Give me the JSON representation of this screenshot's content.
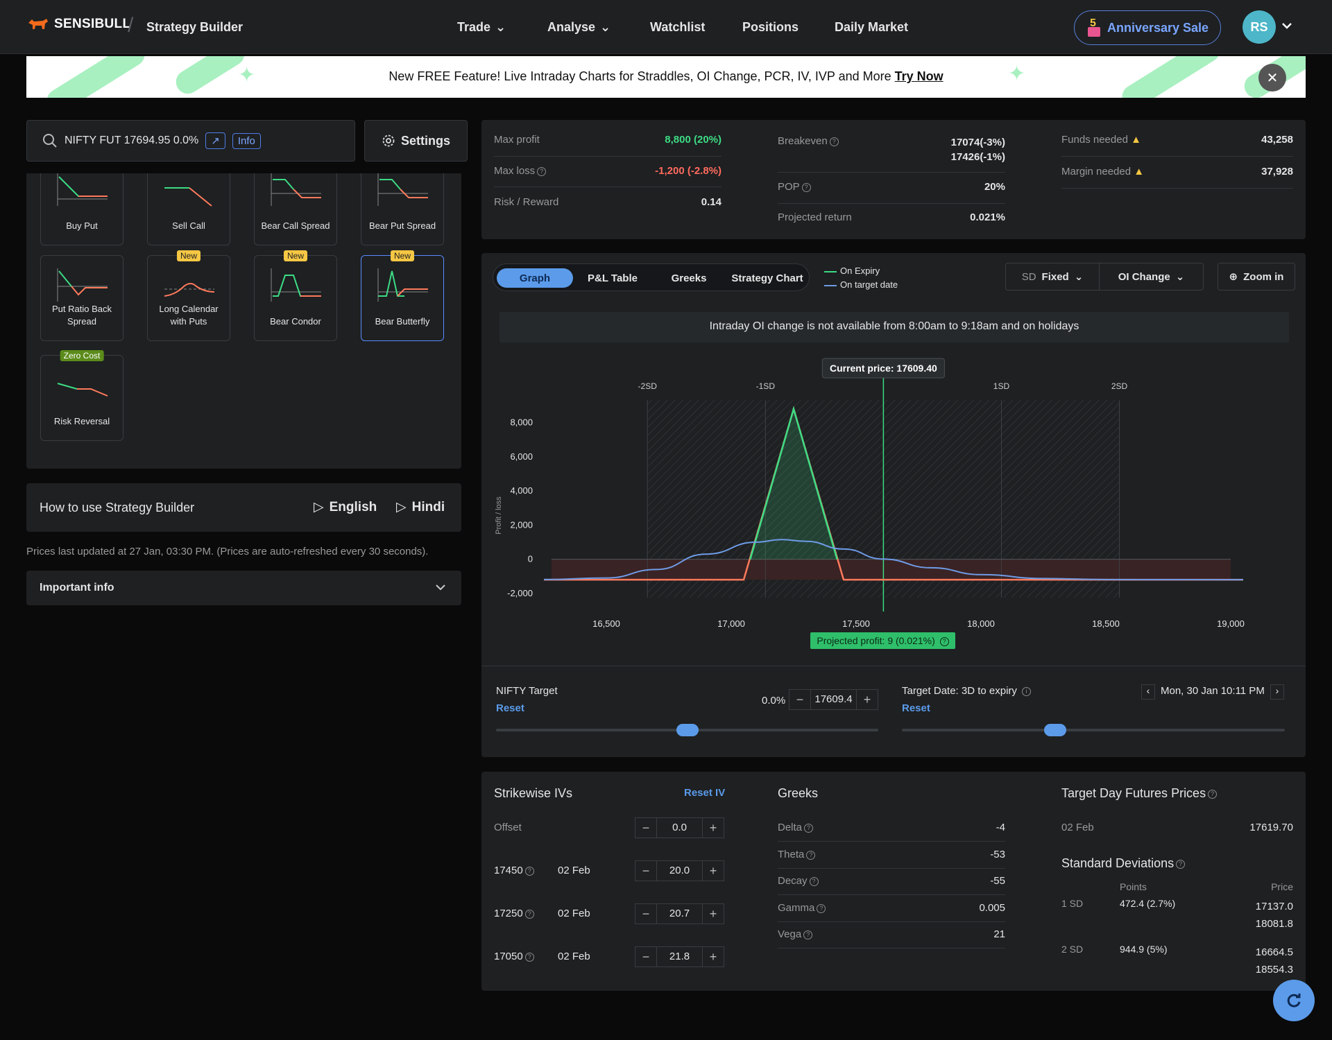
{
  "nav": {
    "brand": "SENSIBULL",
    "section": "Strategy Builder",
    "links": [
      "Trade",
      "Analyse",
      "Watchlist",
      "Positions",
      "Daily Market"
    ],
    "sale": "Anniversary Sale",
    "sale_num": "5",
    "avatar": "RS"
  },
  "banner": {
    "text": "New FREE Feature! Live Intraday Charts for Straddles, OI Change, PCR, IV, IVP and More ",
    "cta": "Try Now"
  },
  "search": {
    "text": "NIFTY FUT 17694.95 0.0%",
    "info": "Info",
    "settings": "Settings"
  },
  "strategies": [
    {
      "label": "Buy Put"
    },
    {
      "label": "Sell Call"
    },
    {
      "label": "Bear Call Spread"
    },
    {
      "label": "Bear Put Spread"
    },
    {
      "label": "Put Ratio Back Spread"
    },
    {
      "label": "Long Calendar with Puts",
      "badge": "New"
    },
    {
      "label": "Bear Condor",
      "badge": "New"
    },
    {
      "label": "Bear Butterfly",
      "badge": "New"
    },
    {
      "label": "Risk Reversal",
      "badge": "Zero Cost"
    }
  ],
  "howto": {
    "title": "How to use Strategy Builder",
    "english": "English",
    "hindi": "Hindi"
  },
  "updated": "Prices last updated at 27 Jan, 03:30 PM. (Prices are auto-refreshed every 30 seconds).",
  "important": "Important info",
  "summary": {
    "max_profit_label": "Max profit",
    "max_profit": "8,800 (20%)",
    "max_loss_label": "Max loss",
    "max_loss": "-1,200 (-2.8%)",
    "rr_label": "Risk / Reward",
    "rr": "0.14",
    "be_label": "Breakeven",
    "be1": "17074(-3%)",
    "be2": "17426(-1%)",
    "pop_label": "POP",
    "pop": "20%",
    "proj_label": "Projected return",
    "proj": "0.021%",
    "funds_label": "Funds needed",
    "funds": "43,258",
    "margin_label": "Margin needed",
    "margin": "37,928"
  },
  "tabs": [
    "Graph",
    "P&L Table",
    "Greeks",
    "Strategy Chart"
  ],
  "legend": {
    "expiry": "On Expiry",
    "target": "On target date"
  },
  "controls": {
    "sd_prefix": "SD",
    "sd": "Fixed",
    "oi": "OI Change",
    "zoom": "Zoom in"
  },
  "oi_note": "Intraday OI change is not available from 8:00am to 9:18am and on holidays",
  "chart_data": {
    "type": "line",
    "ylabel": "Profit / loss",
    "xlim": [
      16250,
      19050
    ],
    "ylim": [
      -2250,
      9000
    ],
    "x_ticks": [
      16500,
      17000,
      17500,
      18000,
      18500,
      19000
    ],
    "x_tick_labels": [
      "16,500",
      "17,000",
      "17,500",
      "18,000",
      "18,500",
      "19,000"
    ],
    "y_ticks": [
      8000,
      6000,
      4000,
      2000,
      0,
      -2000
    ],
    "y_tick_labels": [
      "8,000",
      "6,000",
      "4,000",
      "2,000",
      "0",
      "-2,000"
    ],
    "sd_lines": [
      {
        "label": "-2SD",
        "x": 16664.5
      },
      {
        "label": "-1SD",
        "x": 17137.0
      },
      {
        "label": "1SD",
        "x": 18081.8
      },
      {
        "label": "2SD",
        "x": 18554.3
      }
    ],
    "current_price": {
      "label": "Current price: 17609.40",
      "x": 17609.4
    },
    "series": [
      {
        "name": "On Expiry",
        "color": "#3ddc84",
        "points": [
          [
            16250,
            -1200
          ],
          [
            17000,
            -1200
          ],
          [
            17050,
            -1200
          ],
          [
            17250,
            8800
          ],
          [
            17450,
            -1200
          ],
          [
            19050,
            -1200
          ]
        ]
      },
      {
        "name": "On target date",
        "color": "#6f9ce8",
        "points": [
          [
            16250,
            -1190
          ],
          [
            16500,
            -1100
          ],
          [
            16700,
            -600
          ],
          [
            16900,
            300
          ],
          [
            17100,
            1000
          ],
          [
            17200,
            1150
          ],
          [
            17300,
            1050
          ],
          [
            17450,
            600
          ],
          [
            17609,
            9
          ],
          [
            17800,
            -500
          ],
          [
            18000,
            -900
          ],
          [
            18250,
            -1130
          ],
          [
            18500,
            -1190
          ],
          [
            19050,
            -1200
          ]
        ]
      }
    ],
    "projected": "Projected profit: 9 (0.021%)"
  },
  "target": {
    "label": "NIFTY Target",
    "reset": "Reset",
    "pct": "0.0%",
    "value": "17609.4",
    "slider": 0.5,
    "date_label": "Target Date:",
    "date_expiry": "3D to expiry",
    "date": "Mon, 30 Jan 10:11 PM",
    "date_slider": 0.4
  },
  "ivs": {
    "title": "Strikewise IVs",
    "reset": "Reset IV",
    "offset_label": "Offset",
    "offset": "0.0",
    "rows": [
      {
        "strike": "17450",
        "date": "02 Feb",
        "iv": "20.0"
      },
      {
        "strike": "17250",
        "date": "02 Feb",
        "iv": "20.7"
      },
      {
        "strike": "17050",
        "date": "02 Feb",
        "iv": "21.8"
      }
    ]
  },
  "greeks": {
    "title": "Greeks",
    "rows": [
      {
        "k": "Delta",
        "v": "-4"
      },
      {
        "k": "Theta",
        "v": "-53"
      },
      {
        "k": "Decay",
        "v": "-55"
      },
      {
        "k": "Gamma",
        "v": "0.005"
      },
      {
        "k": "Vega",
        "v": "21"
      }
    ]
  },
  "futures": {
    "title": "Target Day Futures Prices",
    "date": "02 Feb",
    "price": "17619.70",
    "sd_title": "Standard Deviations",
    "col_points": "Points",
    "col_price": "Price",
    "sd": [
      {
        "k": "1 SD",
        "pts": "472.4 (2.7%)",
        "p1": "17137.0",
        "p2": "18081.8"
      },
      {
        "k": "2 SD",
        "pts": "944.9 (5%)",
        "p1": "16664.5",
        "p2": "18554.3"
      }
    ]
  }
}
